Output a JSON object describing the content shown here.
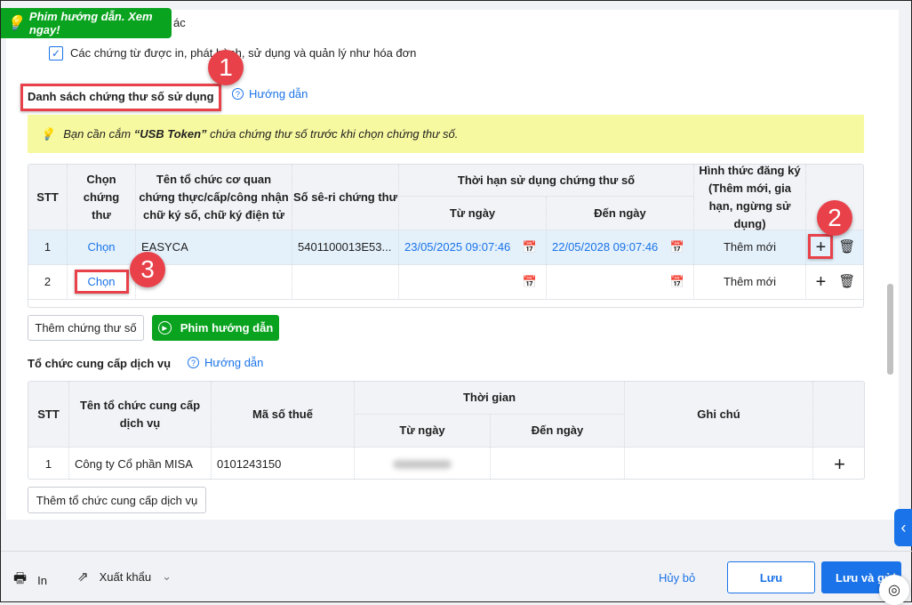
{
  "tooltip": {
    "text": "Phim hướng dẫn. Xem ngay!"
  },
  "partial_text": "ác",
  "checkbox": {
    "label": "Các chứng từ được in, phát hành, sử dụng và quản lý như hóa đơn",
    "checked": true
  },
  "cert_section": {
    "title": "Danh sách chứng thư số sử dụng",
    "help": "Hướng dẫn",
    "notice_pre": "Bạn cần cắm ",
    "notice_bold": "“USB Token”",
    "notice_post": " chứa chứng thư số trước khi chọn chứng thư số.",
    "headers": {
      "stt": "STT",
      "choose": "Chọn chứng thư",
      "org": "Tên tổ chức cơ quan chứng thực/cấp/công nhận chữ ký số, chữ ký điện tử",
      "serial": "Số sê-ri chứng thư",
      "period": "Thời hạn sử dụng chứng thư số",
      "from": "Từ ngày",
      "to": "Đến ngày",
      "type": "Hình thức đăng ký (Thêm mới, gia hạn, ngừng sử dụng)"
    },
    "rows": [
      {
        "stt": "1",
        "choose": "Chọn",
        "org": "EASYCA",
        "serial": "5401100013E53...",
        "from": "23/05/2025 09:07:46",
        "to": "22/05/2028 09:07:46",
        "type": "Thêm mới"
      },
      {
        "stt": "2",
        "choose": "Chọn",
        "org": "",
        "serial": "",
        "from": "",
        "to": "",
        "type": "Thêm mới"
      }
    ],
    "add_button": "Thêm chứng thư số",
    "video_button": "Phim hướng dẫn"
  },
  "provider_section": {
    "title": "Tổ chức cung cấp dịch vụ",
    "help": "Hướng dẫn",
    "headers": {
      "stt": "STT",
      "name": "Tên tổ chức cung cấp dịch vụ",
      "tax": "Mã số thuế",
      "time": "Thời gian",
      "from": "Từ ngày",
      "to": "Đến ngày",
      "note": "Ghi chú"
    },
    "rows": [
      {
        "stt": "1",
        "name": "Công ty Cổ phần MISA",
        "tax": "0101243150",
        "from": "",
        "to": "",
        "note": ""
      }
    ],
    "add_button": "Thêm tổ chức cung cấp dịch vụ"
  },
  "badges": [
    "1",
    "2",
    "3"
  ],
  "footer": {
    "print": "In",
    "export": "Xuất khẩu",
    "cancel": "Hủy bỏ",
    "save": "Lưu",
    "save_send": "Lưu và gửi"
  },
  "colors": {
    "accent": "#1a73e8",
    "green": "#0aa31f",
    "badge": "#e8414a",
    "notice": "#f7f9a0",
    "row_selected": "#e4f1fb"
  }
}
